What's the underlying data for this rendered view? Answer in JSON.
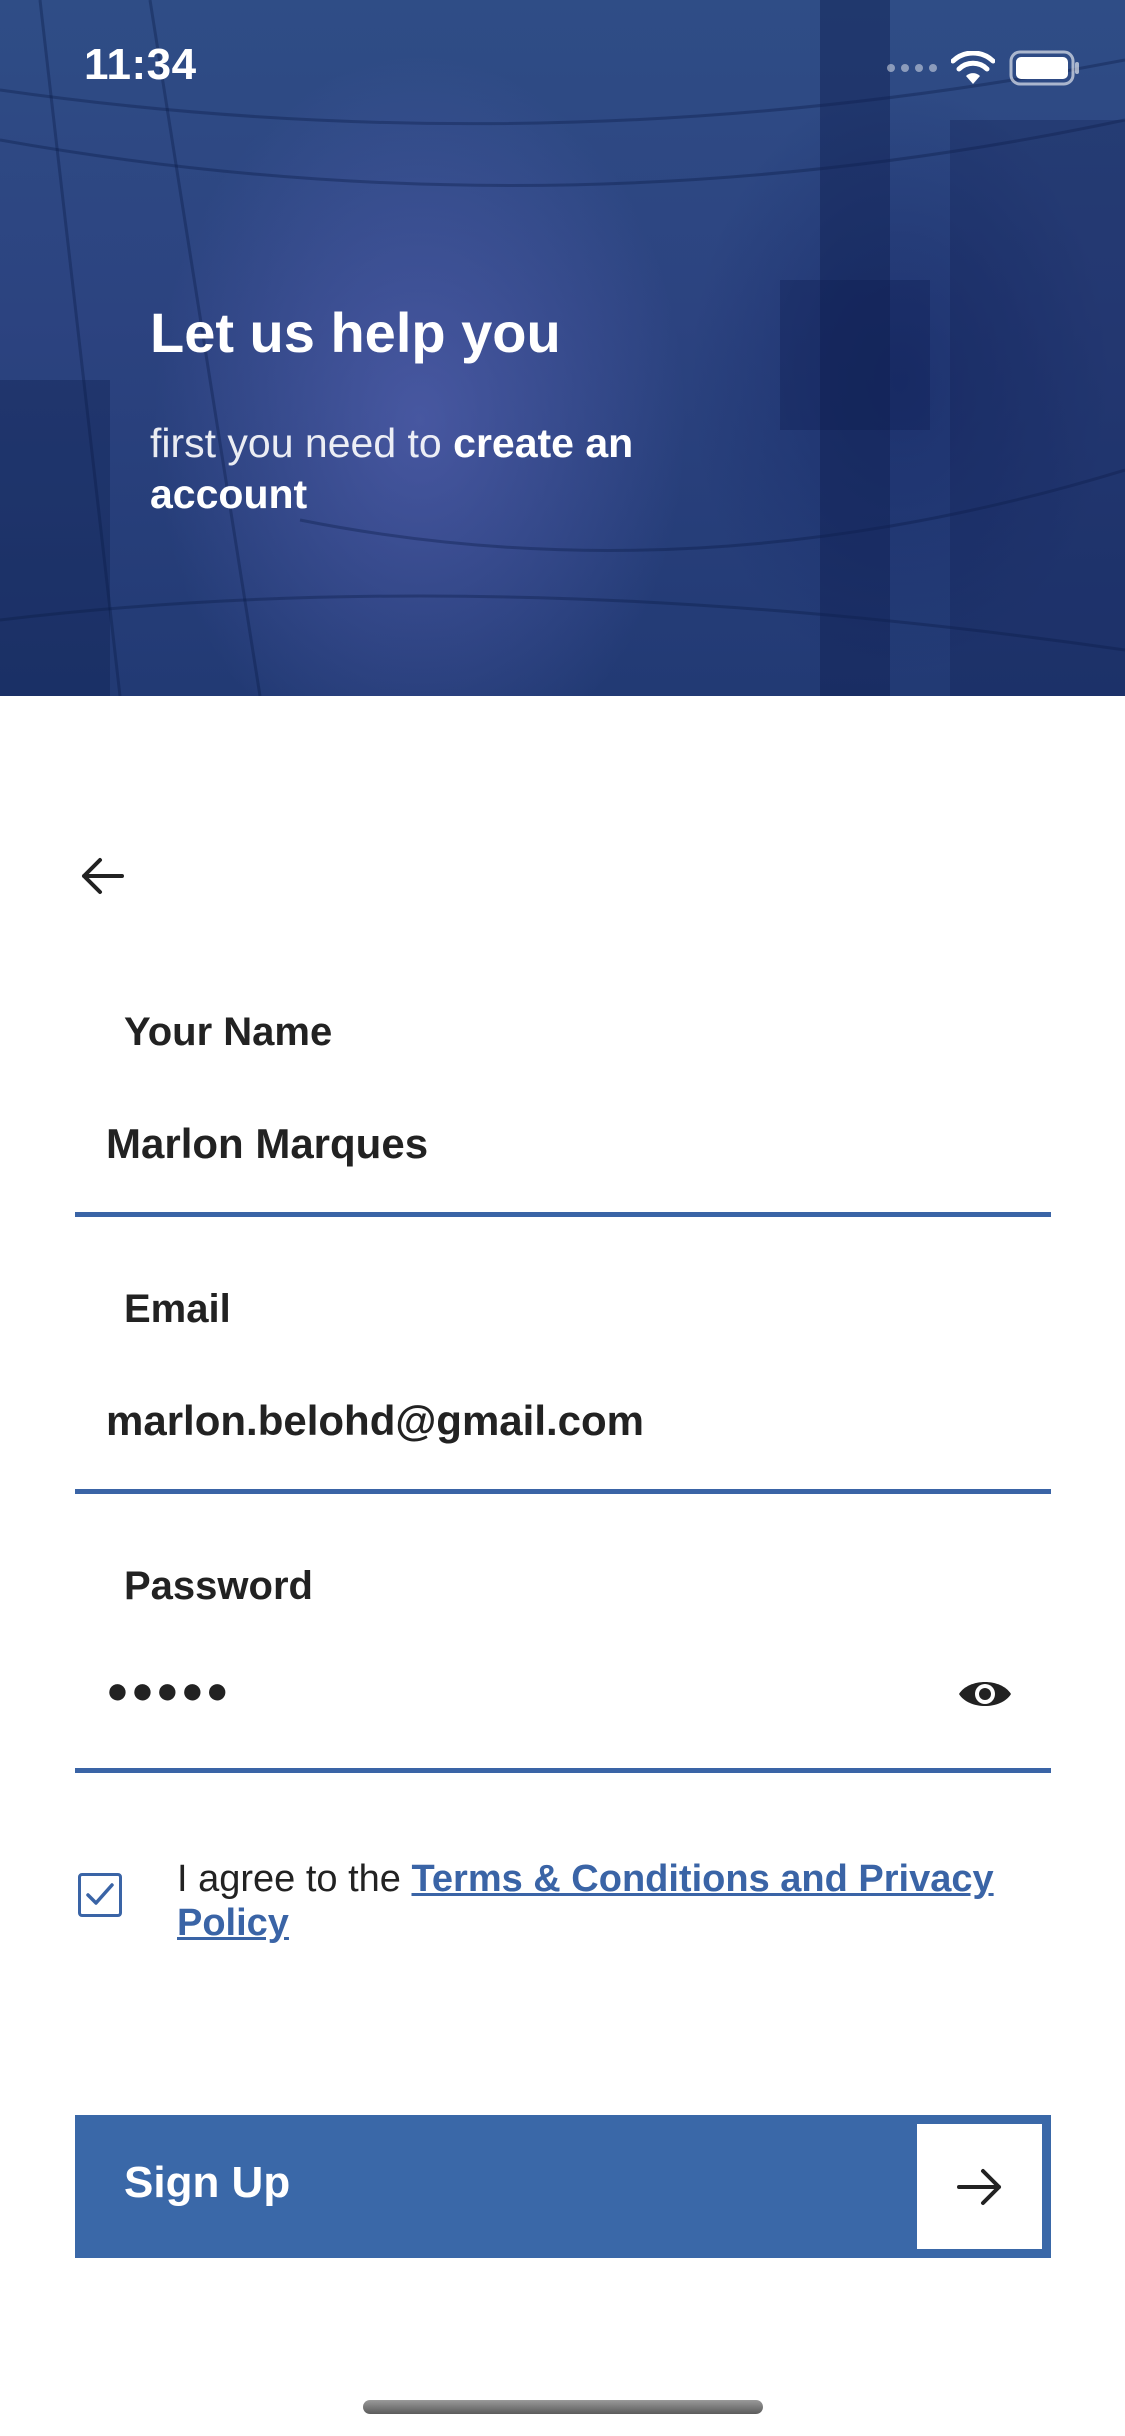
{
  "status_bar": {
    "time": "11:34",
    "icons": [
      "signal-icon",
      "wifi-icon",
      "battery-icon"
    ]
  },
  "hero": {
    "title": "Let us help you",
    "subtitle_light": "first you need to",
    "subtitle_bold": "create an account"
  },
  "navigation": {
    "back_icon": "arrow-left-icon"
  },
  "form": {
    "name": {
      "label": "Your Name",
      "value": "Marlon Marques"
    },
    "email": {
      "label": "Email",
      "value": "marlon.belohd@gmail.com"
    },
    "password": {
      "label": "Password",
      "value": "●●●●●",
      "toggle_icon": "eye-icon"
    }
  },
  "agreement": {
    "checked": true,
    "prefix": "I agree to the",
    "link": "Terms & Conditions and Privacy Policy"
  },
  "signup": {
    "label": "Sign Up",
    "icon": "arrow-right-icon"
  },
  "colors": {
    "accent": "#3a64a6",
    "button": "#3a68a8",
    "hero_dark": "#223a74",
    "text": "#222222"
  }
}
